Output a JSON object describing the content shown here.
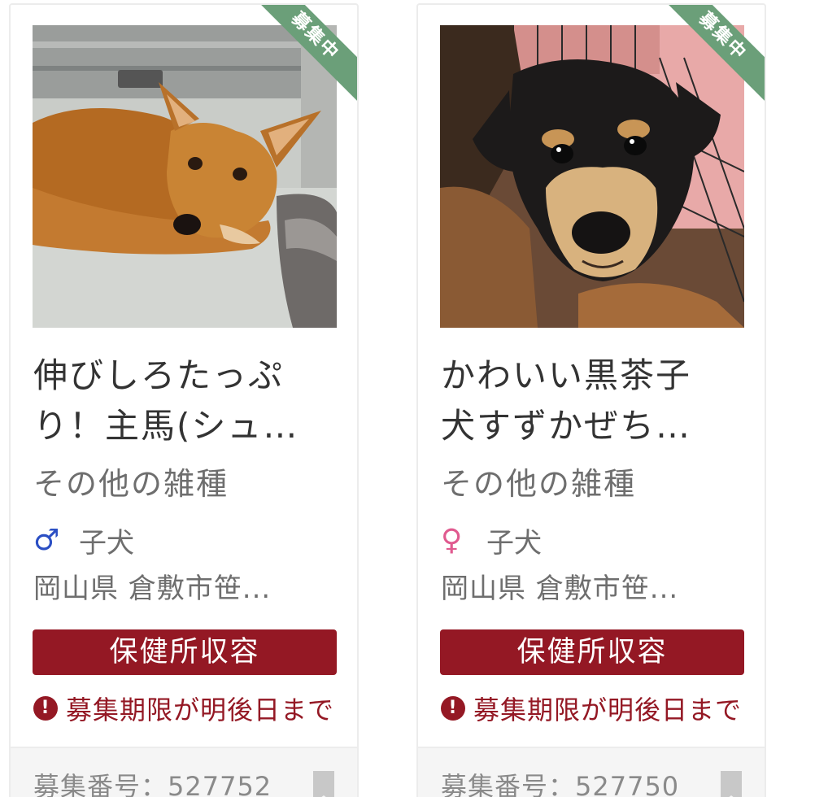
{
  "cards": [
    {
      "ribbon": "募集中",
      "title": "伸びしろたっぷり！主馬(シュ…",
      "breed": "その他の雑種",
      "sex": "male",
      "sex_symbol": "♂",
      "age": "子犬",
      "location": "岡山県 倉敷市笹...",
      "status": "保健所収容",
      "deadline": "募集期限が明後日まで",
      "recruit_no": "募集番号：527752"
    },
    {
      "ribbon": "募集中",
      "title": "かわいい黒茶子犬すずかぜち…",
      "breed": "その他の雑種",
      "sex": "female",
      "sex_symbol": "♀",
      "age": "子犬",
      "location": "岡山県 倉敷市笹...",
      "status": "保健所収容",
      "deadline": "募集期限が明後日まで",
      "recruit_no": "募集番号：527750"
    }
  ],
  "colors": {
    "ribbon": "#6b9f79",
    "status_badge": "#941824",
    "deadline": "#941824",
    "male": "#2b4fc4",
    "female": "#e05a8f"
  },
  "icons": {
    "male": "male-symbol-icon",
    "female": "female-symbol-icon",
    "warning": "exclamation-circle-icon",
    "bookmark": "bookmark-icon"
  }
}
